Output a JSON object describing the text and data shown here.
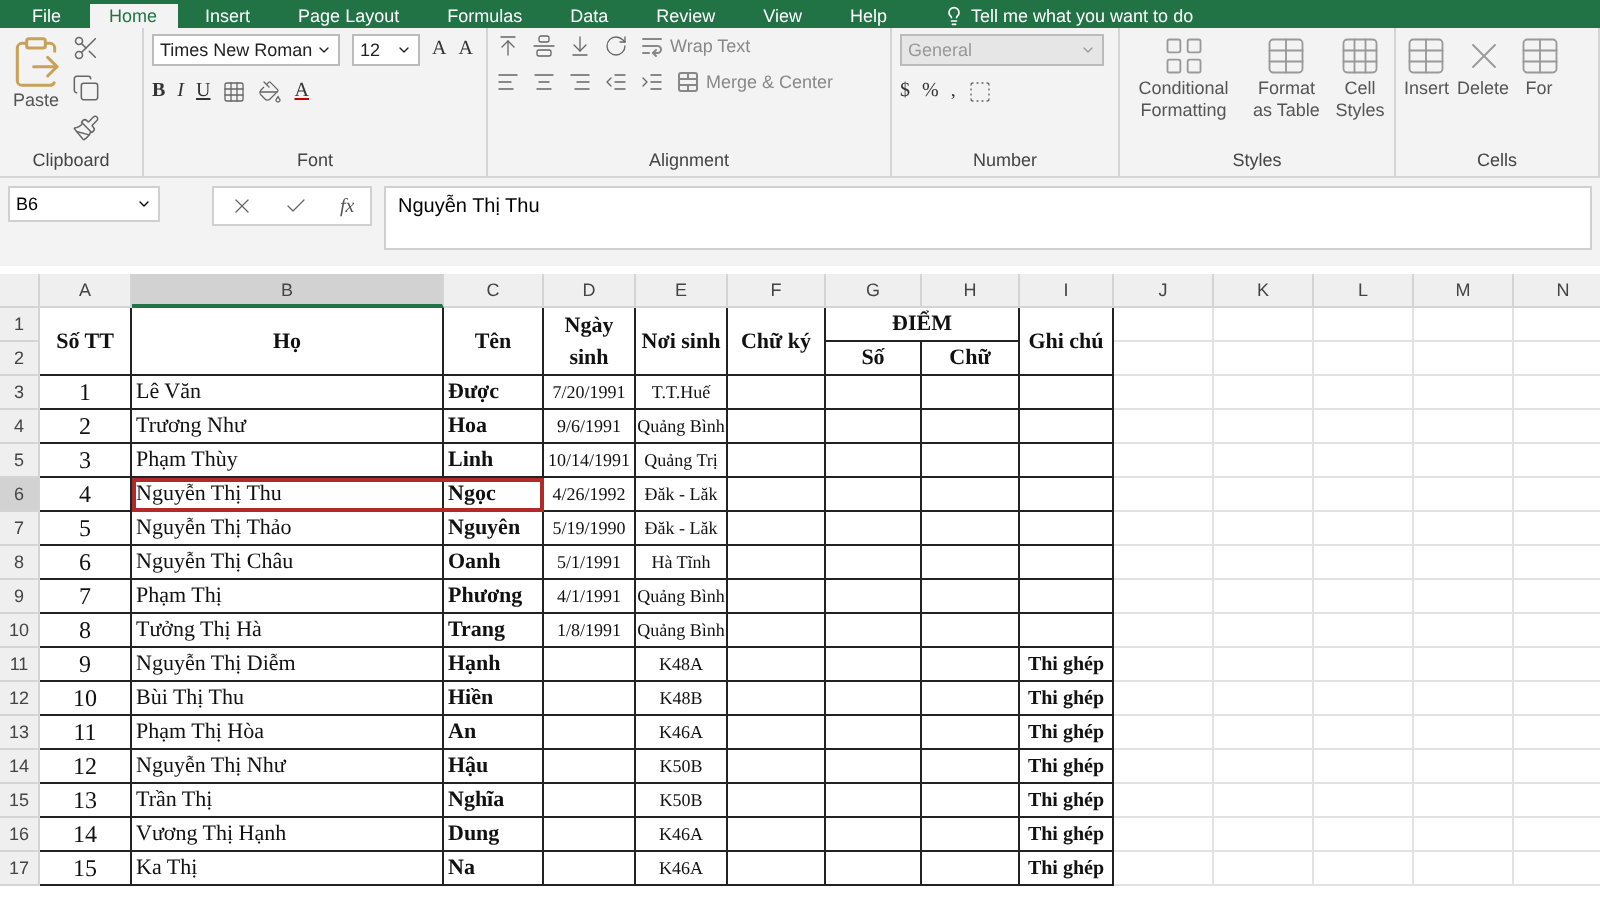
{
  "tabs": [
    {
      "label": "File",
      "selected": false
    },
    {
      "label": "Home",
      "selected": true
    },
    {
      "label": "Insert",
      "selected": false
    },
    {
      "label": "Page Layout",
      "selected": false
    },
    {
      "label": "Formulas",
      "selected": false
    },
    {
      "label": "Data",
      "selected": false
    },
    {
      "label": "Review",
      "selected": false
    },
    {
      "label": "View",
      "selected": false
    },
    {
      "label": "Help",
      "selected": false
    }
  ],
  "tell_me": "Tell me what you want to do",
  "ribbon": {
    "clipboard": {
      "label": "Clipboard",
      "paste": "Paste"
    },
    "font": {
      "label": "Font",
      "name": "Times New Roman",
      "size": "12",
      "grow": "A",
      "shrink": "A",
      "bold": "B",
      "italic": "I",
      "underline": "U",
      "color_letter": "A"
    },
    "alignment": {
      "label": "Alignment",
      "wrap": "Wrap Text",
      "merge": "Merge & Center"
    },
    "number": {
      "label": "Number",
      "format": "General",
      "currency": "$",
      "percent": "%",
      "comma": ","
    },
    "styles": {
      "label": "Styles",
      "buttons": [
        "Conditional Formatting",
        "Format as Table",
        "Cell Styles"
      ]
    },
    "cells": {
      "label": "Cells",
      "buttons": [
        "Insert",
        "Delete",
        "For"
      ]
    }
  },
  "formula_bar": {
    "name_box": "B6",
    "fx": "fx",
    "formula": "Nguyễn Thị Thu"
  },
  "columns": [
    {
      "label": "A",
      "selected": false
    },
    {
      "label": "B",
      "selected": true
    },
    {
      "label": "C",
      "selected": false
    },
    {
      "label": "D",
      "selected": false
    },
    {
      "label": "E",
      "selected": false
    },
    {
      "label": "F",
      "selected": false
    },
    {
      "label": "G",
      "selected": false
    },
    {
      "label": "H",
      "selected": false
    },
    {
      "label": "I",
      "selected": false
    },
    {
      "label": "J",
      "selected": false
    },
    {
      "label": "K",
      "selected": false
    },
    {
      "label": "L",
      "selected": false
    },
    {
      "label": "M",
      "selected": false
    },
    {
      "label": "N",
      "selected": false
    }
  ],
  "header_row_numbers": [
    "1",
    "2"
  ],
  "header": {
    "stt": "Số TT",
    "ho": "Họ",
    "ten": "Tên",
    "ngay": "Ngày sinh",
    "noi": "Nơi sinh",
    "chuky": "Chữ ký",
    "diem": "ĐIỂM",
    "so": "Số",
    "chu": "Chữ",
    "ghichu": "Ghi chú"
  },
  "rows": [
    {
      "num": "3",
      "tt": "1",
      "ho": "Lê Văn",
      "ten": "Được",
      "ngay": "7/20/1991",
      "noi": "T.T.Huế",
      "ghi": "",
      "selected": false
    },
    {
      "num": "4",
      "tt": "2",
      "ho": "Trương Như",
      "ten": "Hoa",
      "ngay": "9/6/1991",
      "noi": "Quảng Bình",
      "ghi": "",
      "selected": false
    },
    {
      "num": "5",
      "tt": "3",
      "ho": "Phạm Thùy",
      "ten": "Linh",
      "ngay": "10/14/1991",
      "noi": "Quảng Trị",
      "ghi": "",
      "selected": false
    },
    {
      "num": "6",
      "tt": "4",
      "ho": "Nguyễn Thị Thu",
      "ten": "Ngọc",
      "ngay": "4/26/1992",
      "noi": "Đăk - Lăk",
      "ghi": "",
      "selected": true
    },
    {
      "num": "7",
      "tt": "5",
      "ho": "Nguyễn Thị Thảo",
      "ten": "Nguyên",
      "ngay": "5/19/1990",
      "noi": "Đăk - Lăk",
      "ghi": "",
      "selected": false
    },
    {
      "num": "8",
      "tt": "6",
      "ho": "Nguyễn Thị Châu",
      "ten": "Oanh",
      "ngay": "5/1/1991",
      "noi": "Hà Tĩnh",
      "ghi": "",
      "selected": false
    },
    {
      "num": "9",
      "tt": "7",
      "ho": "Phạm Thị",
      "ten": "Phương",
      "ngay": "4/1/1991",
      "noi": "Quảng Bình",
      "ghi": "",
      "selected": false
    },
    {
      "num": "10",
      "tt": "8",
      "ho": "Tưởng Thị Hà",
      "ten": "Trang",
      "ngay": "1/8/1991",
      "noi": "Quảng Bình",
      "ghi": "",
      "selected": false
    },
    {
      "num": "11",
      "tt": "9",
      "ho": "Nguyễn Thị Diễm",
      "ten": "Hạnh",
      "ngay": "",
      "noi": "K48A",
      "ghi": "Thi ghép",
      "selected": false
    },
    {
      "num": "12",
      "tt": "10",
      "ho": "Bùi Thị Thu",
      "ten": "Hiền",
      "ngay": "",
      "noi": "K48B",
      "ghi": "Thi ghép",
      "selected": false
    },
    {
      "num": "13",
      "tt": "11",
      "ho": "Phạm Thị Hòa",
      "ten": "An",
      "ngay": "",
      "noi": "K46A",
      "ghi": "Thi ghép",
      "selected": false
    },
    {
      "num": "14",
      "tt": "12",
      "ho": "Nguyễn Thị Như",
      "ten": "Hậu",
      "ngay": "",
      "noi": "K50B",
      "ghi": "Thi ghép",
      "selected": false
    },
    {
      "num": "15",
      "tt": "13",
      "ho": "Trần Thị",
      "ten": "Nghĩa",
      "ngay": "",
      "noi": "K50B",
      "ghi": "Thi ghép",
      "selected": false
    },
    {
      "num": "16",
      "tt": "14",
      "ho": "Vương Thị Hạnh",
      "ten": "Dung",
      "ngay": "",
      "noi": "K46A",
      "ghi": "Thi ghép",
      "selected": false
    },
    {
      "num": "17",
      "tt": "15",
      "ho": "Ka Thị",
      "ten": "Na",
      "ngay": "",
      "noi": "K46A",
      "ghi": "Thi ghép",
      "selected": false
    }
  ]
}
